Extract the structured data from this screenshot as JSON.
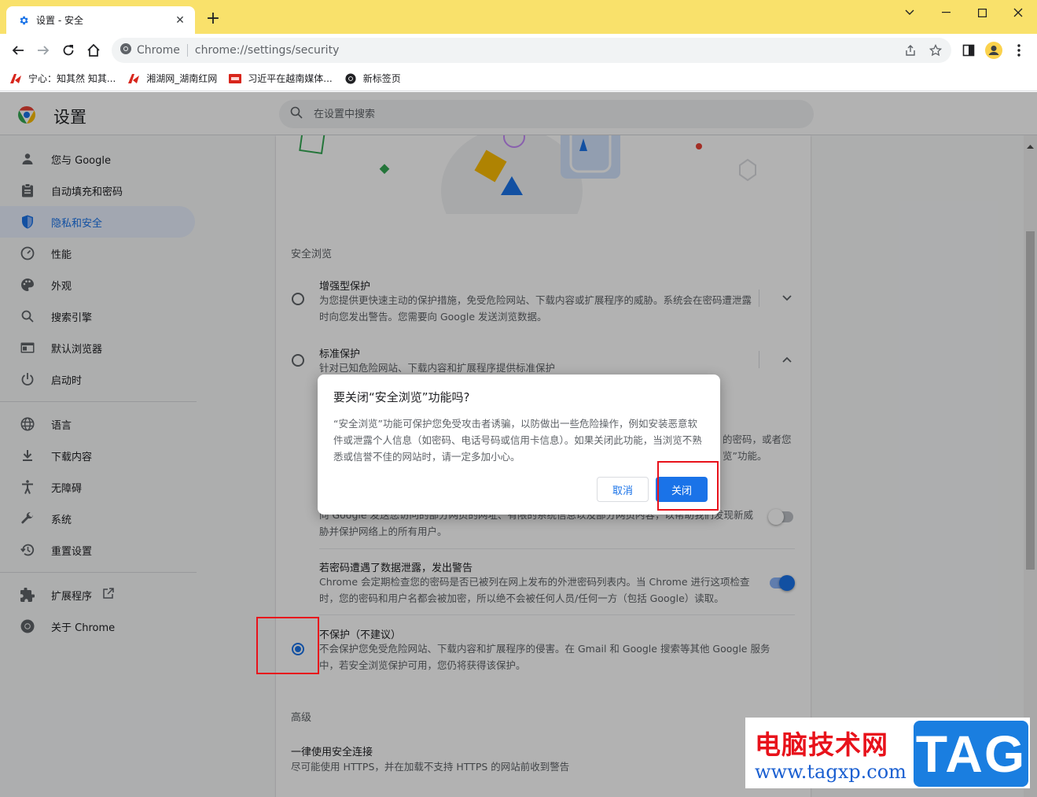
{
  "browser": {
    "tab_title": "设置 - 安全",
    "omnibox_origin": "Chrome",
    "omnibox_url": "chrome://settings/security",
    "bookmarks": [
      {
        "label": "宁心：知其然 知其...",
        "icon": "red-bookmark-icon"
      },
      {
        "label": "湘湖网_湖南红网",
        "icon": "red-bookmark-icon"
      },
      {
        "label": "习近平在越南媒体...",
        "icon": "news-bookmark-icon"
      },
      {
        "label": "新标签页",
        "icon": "chrome-icon"
      }
    ]
  },
  "settings": {
    "title": "设置",
    "search_placeholder": "在设置中搜索",
    "nav": [
      {
        "label": "您与 Google",
        "icon": "person-icon"
      },
      {
        "label": "自动填充和密码",
        "icon": "clipboard-icon"
      },
      {
        "label": "隐私和安全",
        "icon": "shield-icon",
        "active": true
      },
      {
        "label": "性能",
        "icon": "speedometer-icon"
      },
      {
        "label": "外观",
        "icon": "palette-icon"
      },
      {
        "label": "搜索引擎",
        "icon": "search-icon"
      },
      {
        "label": "默认浏览器",
        "icon": "browser-icon"
      },
      {
        "label": "启动时",
        "icon": "power-icon"
      }
    ],
    "nav2": [
      {
        "label": "语言",
        "icon": "globe-icon"
      },
      {
        "label": "下载内容",
        "icon": "download-icon"
      },
      {
        "label": "无障碍",
        "icon": "accessibility-icon"
      },
      {
        "label": "系统",
        "icon": "wrench-icon"
      },
      {
        "label": "重置设置",
        "icon": "history-icon"
      }
    ],
    "nav3": [
      {
        "label": "扩展程序",
        "icon": "puzzle-icon"
      },
      {
        "label": "关于 Chrome",
        "icon": "chrome-icon"
      }
    ]
  },
  "security": {
    "section_safe_browsing": "安全浏览",
    "enhanced_title": "增强型保护",
    "enhanced_desc": "为您提供更快速主动的保护措施，免受危险网站、下载内容或扩展程序的威胁。系统会在密码遭泄露时向您发出警告。您需要向 Google 发送浏览数据。",
    "standard_title": "标准保护",
    "standard_desc": "针对已知危险网站、下载内容和扩展程序提供标准保护",
    "partial_right_1": "的密码，或者您",
    "partial_right_2": "览”功能。",
    "help_improve_desc": "向 Google 发送您访问的部分网页的网址、有限的系统信息以及部分网页内容，以帮助我们发现新威胁并保护网络上的所有用户。",
    "help_improve_enabled": false,
    "password_title": "若密码遭遇了数据泄露，发出警告",
    "password_desc": "Chrome 会定期检查您的密码是否已被列在网上发布的外泄密码列表内。当 Chrome 进行这项检查时，您的密码和用户名都会被加密，所以绝不会被任何人员/任何一方（包括 Google）读取。",
    "password_enabled": true,
    "no_protection_title": "不保护（不建议）",
    "no_protection_desc": "不会保护您免受危险网站、下载内容和扩展程序的侵害。在 Gmail 和 Google 搜索等其他 Google 服务中，若安全浏览保护可用，您仍将获得该保护。",
    "selected_option": "no_protection",
    "section_advanced": "高级",
    "https_title": "一律使用安全连接",
    "https_desc": "尽可能使用 HTTPS，并在加载不支持 HTTPS 的网站前收到警告"
  },
  "dialog": {
    "title": "要关闭“安全浏览”功能吗?",
    "body": "“安全浏览”功能可保护您免受攻击者诱骗，以防做出一些危险操作，例如安装恶意软件或泄露个人信息（如密码、电话号码或信用卡信息）。如果关闭此功能，当浏览不熟悉或信誉不佳的网站时，请一定多加小心。",
    "cancel_label": "取消",
    "confirm_label": "关闭"
  },
  "watermark": {
    "cn_text": "电脑技术网",
    "url_text": "www.tagxp.com",
    "tag_text": "TAG"
  },
  "colors": {
    "accent": "#1a73e8",
    "tab_strip": "#f9e16b",
    "annotation": "#e8121b"
  }
}
